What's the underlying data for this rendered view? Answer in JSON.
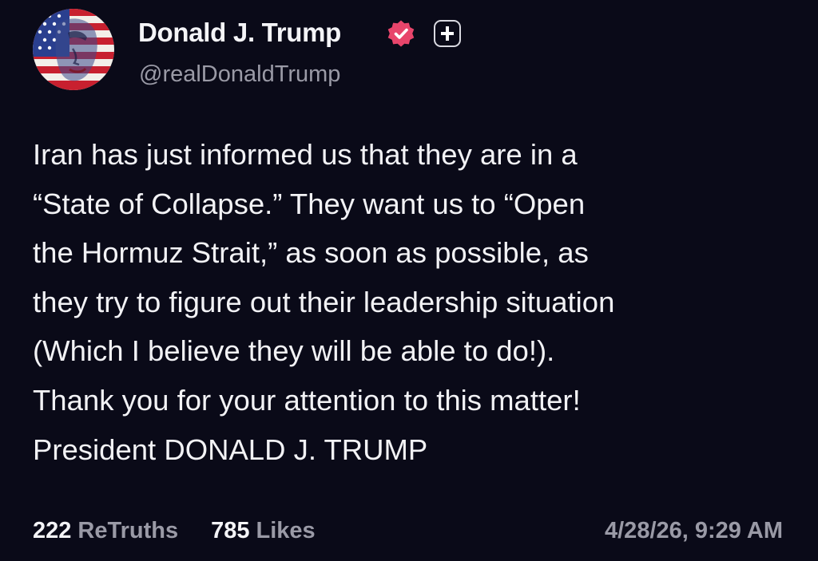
{
  "author": {
    "display_name": "Donald J. Trump",
    "handle": "@realDonaldTrump",
    "verified": true,
    "badge_color": "#e8456b",
    "avatar_icon": "flag-portrait-avatar",
    "follow_icon": "plus-icon"
  },
  "post": {
    "lines": [
      "Iran has just informed us that they are in a",
      "“State of Collapse.” They want us to “Open",
      "the Hormuz Strait,” as soon as possible, as",
      "they try to figure out their leadership situation",
      "(Which I believe they will be able to do!).",
      "Thank you for your attention to this matter!",
      "President DONALD J. TRUMP"
    ]
  },
  "stats": {
    "retruths_count": "222",
    "retruths_label": "ReTruths",
    "likes_count": "785",
    "likes_label": "Likes"
  },
  "timestamp": "4/28/26, 9:29 AM",
  "colors": {
    "background": "#0a0a18",
    "text_primary": "#f2f2f5",
    "text_secondary": "#9a9aa6"
  }
}
